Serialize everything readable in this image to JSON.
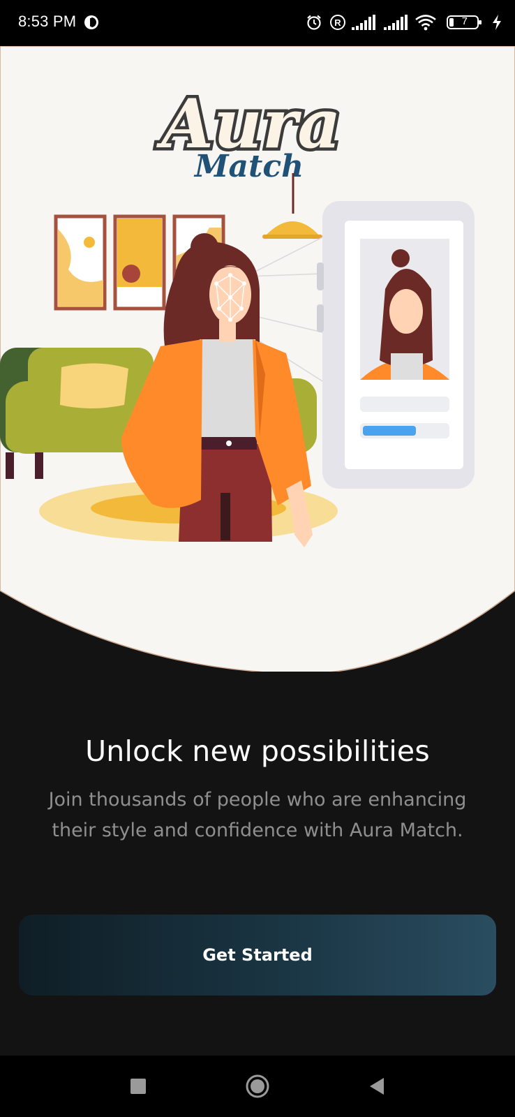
{
  "status_bar": {
    "time": "8:53 PM",
    "battery_level": "7"
  },
  "logo": {
    "line1": "Aura",
    "line2": "Match"
  },
  "onboarding": {
    "title": "Unlock new possibilities",
    "description": "Join thousands of people who are enhancing their style and confidence with Aura Match.",
    "cta_label": "Get Started"
  },
  "colors": {
    "background": "#131313",
    "hero_background": "#f8f6f3",
    "accent_orange": "#ff8a2a",
    "logo_blue": "#1f5276",
    "button_gradient_start": "#0f1e26",
    "button_gradient_end": "#2a4d60"
  },
  "icons": {
    "status_left": "data-saver-icon",
    "status_right": [
      "alarm-icon",
      "registered-icon",
      "signal-icon",
      "signal-icon",
      "wifi-icon",
      "battery-icon",
      "charging-icon"
    ],
    "nav": [
      "recent-apps-icon",
      "home-icon",
      "back-icon"
    ]
  }
}
